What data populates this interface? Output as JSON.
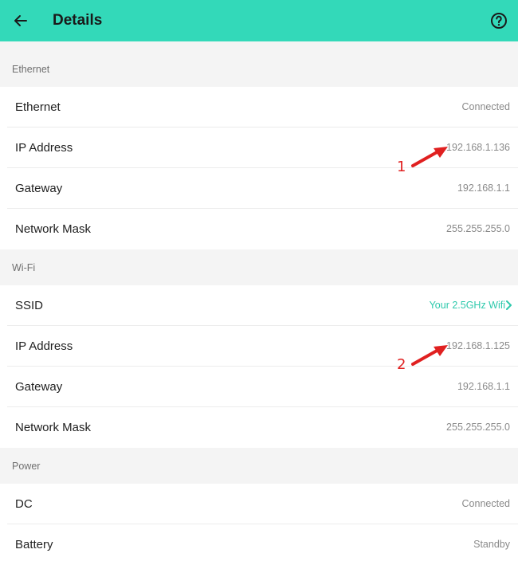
{
  "header": {
    "title": "Details",
    "accent_color": "#33d9b9",
    "back_icon": "arrow-left-icon",
    "help_icon": "help-circle-icon"
  },
  "sections": [
    {
      "title": "Ethernet",
      "rows": [
        {
          "label": "Ethernet",
          "value": "Connected"
        },
        {
          "label": "IP Address",
          "value": "192.168.1.136"
        },
        {
          "label": "Gateway",
          "value": "192.168.1.1"
        },
        {
          "label": "Network Mask",
          "value": "255.255.255.0"
        }
      ]
    },
    {
      "title": "Wi-Fi",
      "rows": [
        {
          "label": "SSID",
          "value": "Your 2.5GHz Wifi"
        },
        {
          "label": "IP Address",
          "value": "192.168.1.125"
        },
        {
          "label": "Gateway",
          "value": "192.168.1.1"
        },
        {
          "label": "Network Mask",
          "value": "255.255.255.0"
        }
      ]
    },
    {
      "title": "Power",
      "rows": [
        {
          "label": "DC",
          "value": "Connected"
        },
        {
          "label": "Battery",
          "value": "Standby"
        }
      ]
    }
  ],
  "annotations": {
    "first": "1",
    "second": "2",
    "color": "#e02020"
  }
}
